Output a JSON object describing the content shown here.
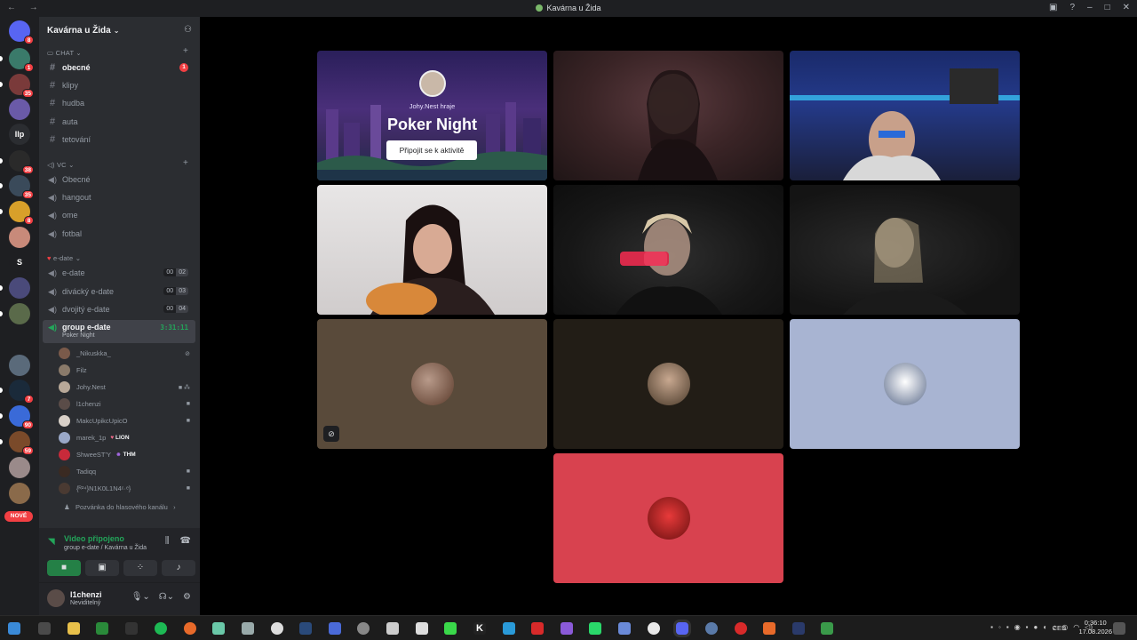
{
  "window": {
    "title": "Kavárna u Žida"
  },
  "servers": {
    "items": [
      {
        "badge": "8"
      },
      {
        "badge": "1"
      },
      {
        "badge": "35"
      },
      {
        "badge": ""
      },
      {
        "label": "llp"
      },
      {
        "badge": "38"
      },
      {
        "badge": "35"
      },
      {
        "badge": "8"
      },
      {
        "badge": ""
      },
      {
        "label": "S"
      },
      {
        "badge": ""
      },
      {
        "badge": ""
      },
      {
        "badge": ""
      },
      {
        "badge": "7"
      },
      {
        "badge": "90"
      },
      {
        "badge": "59"
      },
      {
        "badge": ""
      },
      {
        "badge": ""
      }
    ],
    "new_label": "NOVÉ"
  },
  "guild": {
    "name": "Kavárna u Žida"
  },
  "categories": {
    "chat": "CHAT",
    "vc": "VC",
    "edate": "e-date"
  },
  "text_channels": [
    {
      "name": "obecné",
      "mention": "1"
    },
    {
      "name": "klipy"
    },
    {
      "name": "hudba"
    },
    {
      "name": "auta"
    },
    {
      "name": "tetování"
    }
  ],
  "voice_channels": [
    {
      "name": "Obecné"
    },
    {
      "name": "hangout"
    },
    {
      "name": "ome"
    },
    {
      "name": "fotbal"
    }
  ],
  "edate_channels": [
    {
      "name": "e-date",
      "a": "00",
      "b": "02"
    },
    {
      "name": "divácký e-date",
      "a": "00",
      "b": "03"
    },
    {
      "name": "dvojitý e-date",
      "a": "00",
      "b": "04"
    }
  ],
  "active_channel": {
    "name": "group e-date",
    "activity": "Poker Night",
    "timer": "3:31:11"
  },
  "members": [
    {
      "name": "_Nikuskka_"
    },
    {
      "name": "Filz"
    },
    {
      "name": "Johy.Nest"
    },
    {
      "name": "l1chenzi"
    },
    {
      "name": "MakcUpikcUpicO"
    },
    {
      "name": "marek_1p",
      "tag": "LION"
    },
    {
      "name": "ShweeST'Y",
      "tag": "THM"
    },
    {
      "name": "Tadiqq"
    },
    {
      "name": "{ᴿ²⁴}N1K0L1N4ᶜ·ᵉ}"
    }
  ],
  "invite_link": "Pozvánka do hlasového kanálu",
  "voice_panel": {
    "status": "Video připojeno",
    "where": "group e-date / Kavárna u Žida"
  },
  "userbar": {
    "name": "l1chenzi",
    "status": "Neviditelný"
  },
  "activity_tile": {
    "who": "Johy.Nest hraje",
    "game": "Poker Night",
    "join": "Připojit se k aktivitě"
  },
  "taskbar": {
    "lang": "CES",
    "time": "0:36:10",
    "date": "17.08.2026"
  },
  "colors": {
    "accent_green": "#23a55a",
    "mention_red": "#f23f43",
    "tile_red": "#d8424f",
    "tile_blue": "#a8b4d2"
  }
}
